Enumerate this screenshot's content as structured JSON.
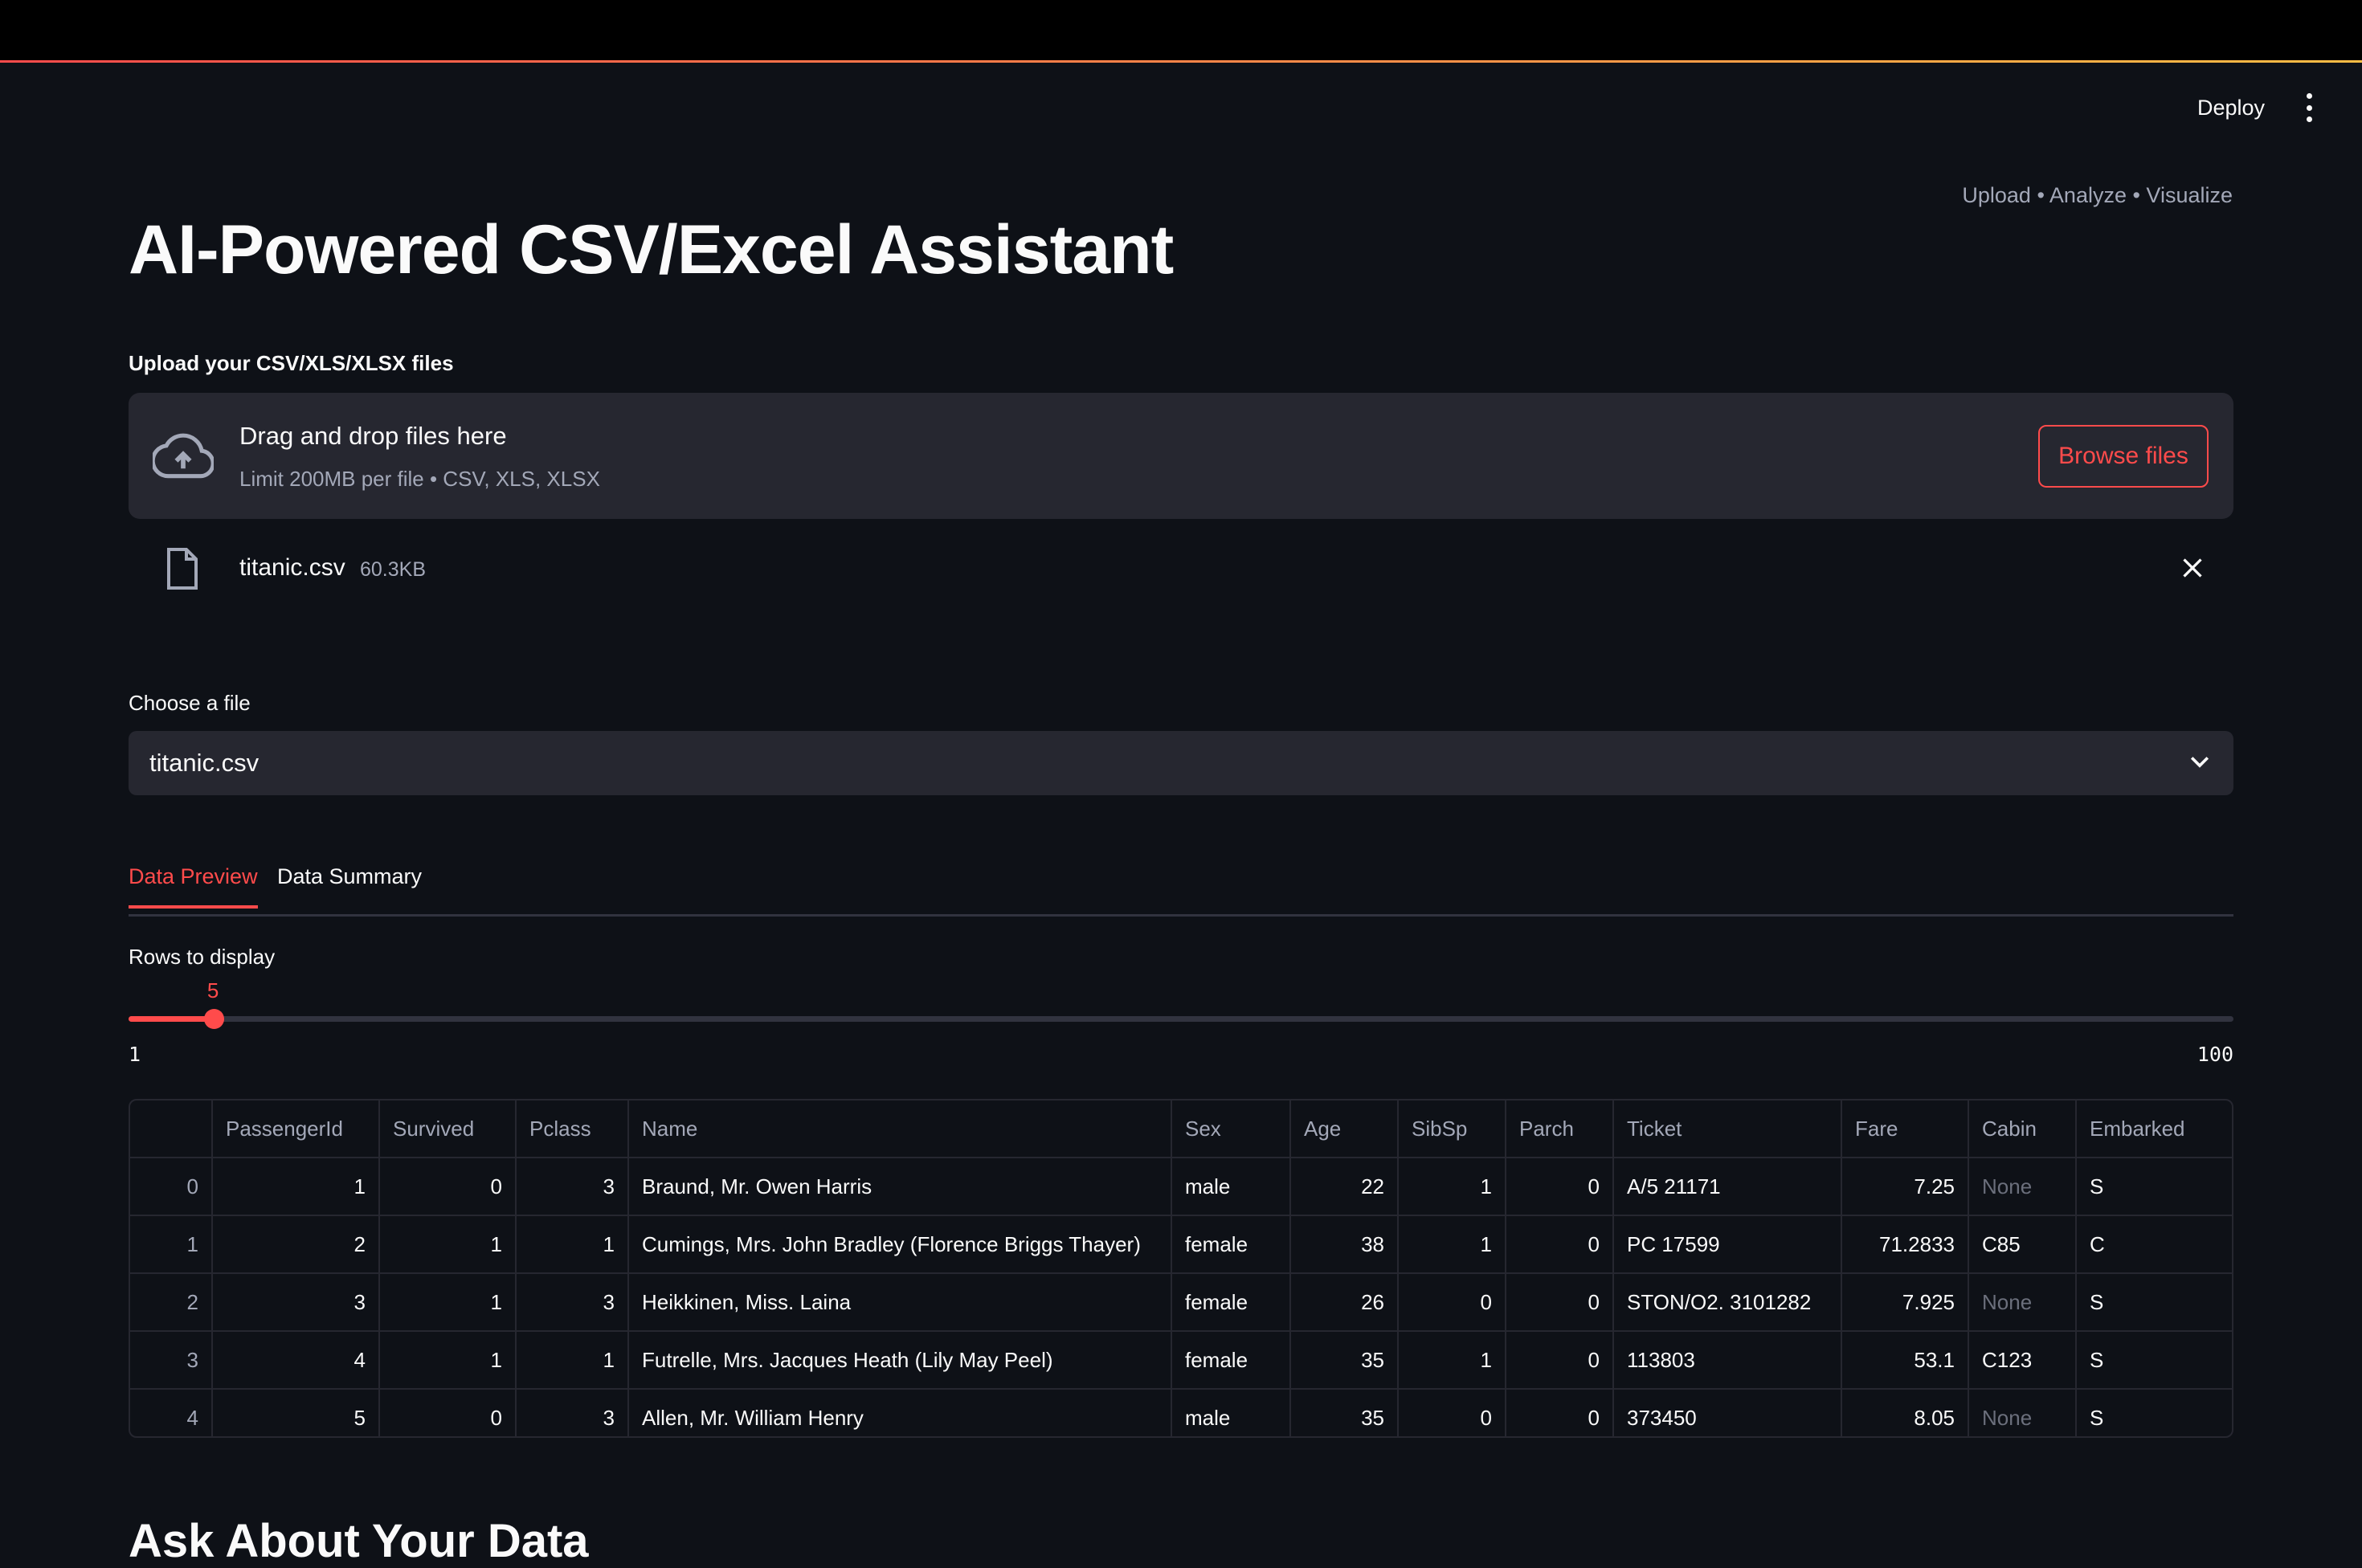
{
  "header": {
    "deploy_label": "Deploy",
    "menu_icon": "more-vertical-icon"
  },
  "tagline": "Upload • Analyze • Visualize",
  "title": "AI-Powered CSV/Excel Assistant",
  "uploader": {
    "label": "Upload your CSV/XLS/XLSX files",
    "drop_title": "Drag and drop files here",
    "drop_subtitle": "Limit 200MB per file • CSV, XLS, XLSX",
    "browse_label": "Browse files",
    "file": {
      "name": "titanic.csv",
      "size": "60.3KB"
    }
  },
  "file_select": {
    "label": "Choose a file",
    "value": "titanic.csv"
  },
  "tabs": [
    {
      "label": "Data Preview",
      "active": true
    },
    {
      "label": "Data Summary",
      "active": false
    }
  ],
  "rows_slider": {
    "label": "Rows to display",
    "value": 5,
    "value_label": "5",
    "min": 1,
    "max": 100,
    "min_label": "1",
    "max_label": "100"
  },
  "table": {
    "columns": [
      "",
      "PassengerId",
      "Survived",
      "Pclass",
      "Name",
      "Sex",
      "Age",
      "SibSp",
      "Parch",
      "Ticket",
      "Fare",
      "Cabin",
      "Embarked"
    ],
    "rows": [
      [
        "0",
        "1",
        "0",
        "3",
        "Braund, Mr. Owen Harris",
        "male",
        "22",
        "1",
        "0",
        "A/5 21171",
        "7.25",
        "None",
        "S"
      ],
      [
        "1",
        "2",
        "1",
        "1",
        "Cumings, Mrs. John Bradley (Florence Briggs Thayer)",
        "female",
        "38",
        "1",
        "0",
        "PC 17599",
        "71.2833",
        "C85",
        "C"
      ],
      [
        "2",
        "3",
        "1",
        "3",
        "Heikkinen, Miss. Laina",
        "female",
        "26",
        "0",
        "0",
        "STON/O2. 3101282",
        "7.925",
        "None",
        "S"
      ],
      [
        "3",
        "4",
        "1",
        "1",
        "Futrelle, Mrs. Jacques Heath (Lily May Peel)",
        "female",
        "35",
        "1",
        "0",
        "113803",
        "53.1",
        "C123",
        "S"
      ],
      [
        "4",
        "5",
        "0",
        "3",
        "Allen, Mr. William Henry",
        "male",
        "35",
        "0",
        "0",
        "373450",
        "8.05",
        "None",
        "S"
      ]
    ]
  },
  "section_heading": "Ask About Your Data",
  "colors": {
    "background": "#0e1117",
    "accent": "#ff4b4b",
    "surface": "#262730",
    "muted_text": "#a3a8b8"
  }
}
